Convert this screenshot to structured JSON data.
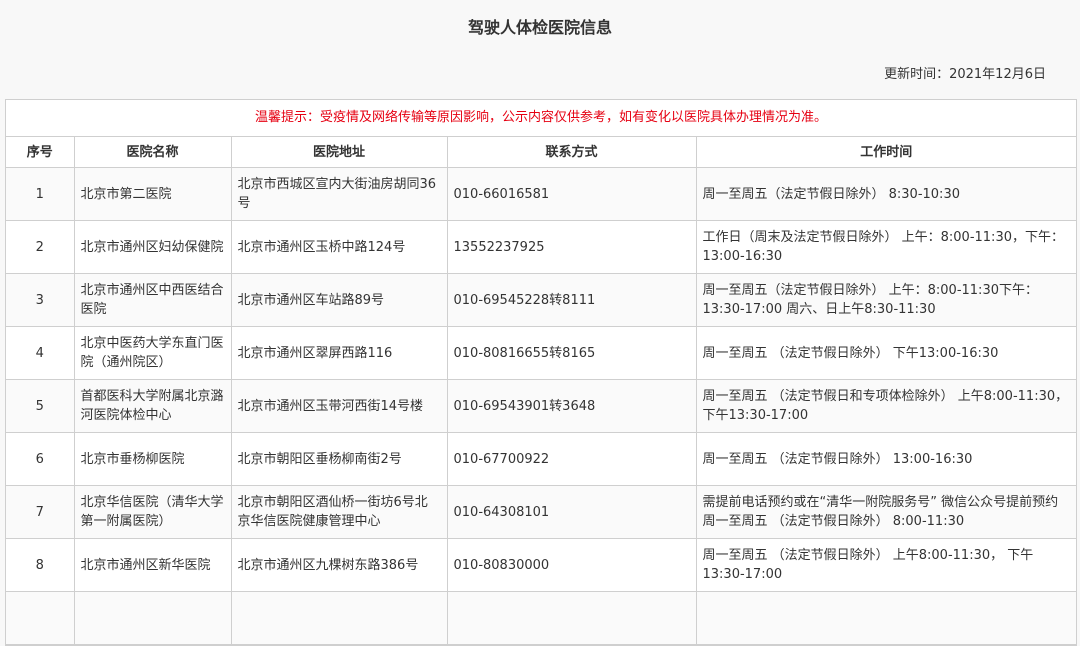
{
  "page": {
    "title": "驾驶人体检医院信息",
    "updated": "更新时间：2021年12月6日",
    "notice": "温馨提示：受疫情及网络传输等原因影响，公示内容仅供参考，如有变化以医院具体办理情况为准。"
  },
  "table": {
    "headers": [
      "序号",
      "医院名称",
      "医院地址",
      "联系方式",
      "工作时间"
    ],
    "rows": [
      {
        "no": "1",
        "name": "北京市第二医院",
        "address": "北京市西城区宣内大街油房胡同36号",
        "phone": "010-66016581",
        "hours": "周一至周五（法定节假日除外） 8:30-10:30"
      },
      {
        "no": "2",
        "name": "北京市通州区妇幼保健院",
        "address": "北京市通州区玉桥中路124号",
        "phone": "13552237925",
        "hours": "工作日（周末及法定节假日除外） 上午：8:00-11:30，下午：13:00-16:30"
      },
      {
        "no": "3",
        "name": "北京市通州区中西医结合医院",
        "address": "北京市通州区车站路89号",
        "phone": "010-69545228转8111",
        "hours": "周一至周五（法定节假日除外） 上午：8:00-11:30下午：13:30-17:00 周六、日上午8:30-11:30"
      },
      {
        "no": "4",
        "name": "北京中医药大学东直门医院（通州院区）",
        "address": "北京市通州区翠屏西路116",
        "phone": "010-80816655转8165",
        "hours": "周一至周五 （法定节假日除外） 下午13:00-16:30"
      },
      {
        "no": "5",
        "name": "首都医科大学附属北京潞河医院体检中心",
        "address": "北京市通州区玉带河西街14号楼",
        "phone": "010-69543901转3648",
        "hours": "周一至周五 （法定节假日和专项体检除外） 上午8:00-11:30， 下午13:30-17:00"
      },
      {
        "no": "6",
        "name": "北京市垂杨柳医院",
        "address": "北京市朝阳区垂杨柳南街2号",
        "phone": "010-67700922",
        "hours": "周一至周五 （法定节假日除外） 13:00-16:30"
      },
      {
        "no": "7",
        "name": "北京华信医院（清华大学第一附属医院）",
        "address": "北京市朝阳区酒仙桥一街坊6号北京华信医院健康管理中心",
        "phone": "010-64308101",
        "hours": "需提前电话预约或在“清华一附院服务号” 微信公众号提前预约 周一至周五 （法定节假日除外） 8:00-11:30"
      },
      {
        "no": "8",
        "name": "北京市通州区新华医院",
        "address": "北京市通州区九棵树东路386号",
        "phone": "010-80830000",
        "hours": "周一至周五 （法定节假日除外） 上午8:00-11:30， 下午13:30-17:00"
      },
      {
        "no": "",
        "name": "",
        "address": "",
        "phone": "",
        "hours": ""
      }
    ]
  }
}
